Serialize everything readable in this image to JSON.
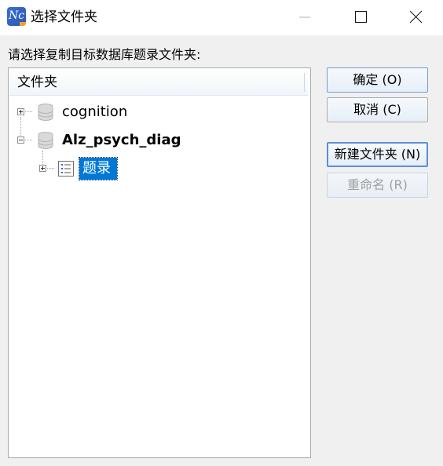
{
  "window": {
    "title": "选择文件夹",
    "icon": "navicat-icon"
  },
  "instruction": "请选择复制目标数据库题录文件夹:",
  "tree": {
    "header": "文件夹",
    "nodes": [
      {
        "label": "cognition",
        "icon": "database-icon",
        "expanded": false,
        "bold": false
      },
      {
        "label": "Alz_psych_diag",
        "icon": "database-icon",
        "expanded": true,
        "bold": true,
        "children": [
          {
            "label": "题录",
            "icon": "list-icon",
            "expanded": false,
            "selected": true
          }
        ]
      }
    ]
  },
  "buttons": {
    "ok": "确定 (O)",
    "cancel": "取消 (C)",
    "new_folder": "新建文件夹 (N)",
    "rename": "重命名 (R)"
  },
  "colors": {
    "selection": "#0078d7",
    "background": "#f0f0f0",
    "titlebar": "#ffffff"
  }
}
